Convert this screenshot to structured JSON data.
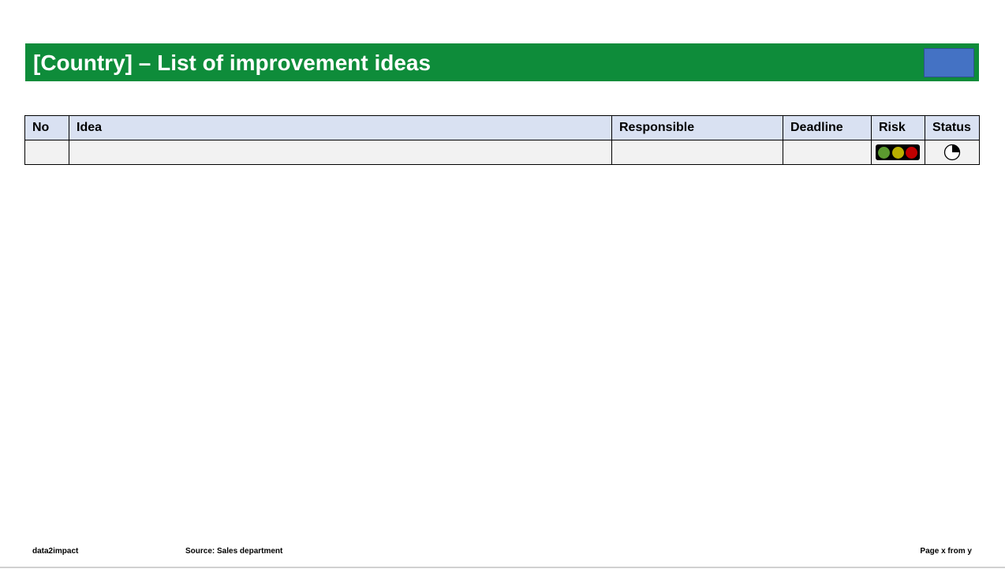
{
  "header": {
    "title": "[Country] – List of improvement ideas",
    "bar_color": "#0e8c3a",
    "logo_placeholder_color": "#4472c4"
  },
  "table": {
    "columns": [
      "No",
      "Idea",
      "Responsible",
      "Deadline",
      "Risk",
      "Status"
    ],
    "header_bg": "#d9e1f2",
    "rows": [
      {
        "no": "",
        "idea": "",
        "responsible": "",
        "deadline": "",
        "risk_icon": "traffic-light-icon",
        "risk_colors": [
          "#5b9a2f",
          "#b9b000",
          "#c00000"
        ],
        "status_icon": "harvey-ball-icon",
        "status_progress": 0.25
      }
    ]
  },
  "footer": {
    "brand": "data2impact",
    "source": "Source: Sales department",
    "page": "Page x from y"
  }
}
